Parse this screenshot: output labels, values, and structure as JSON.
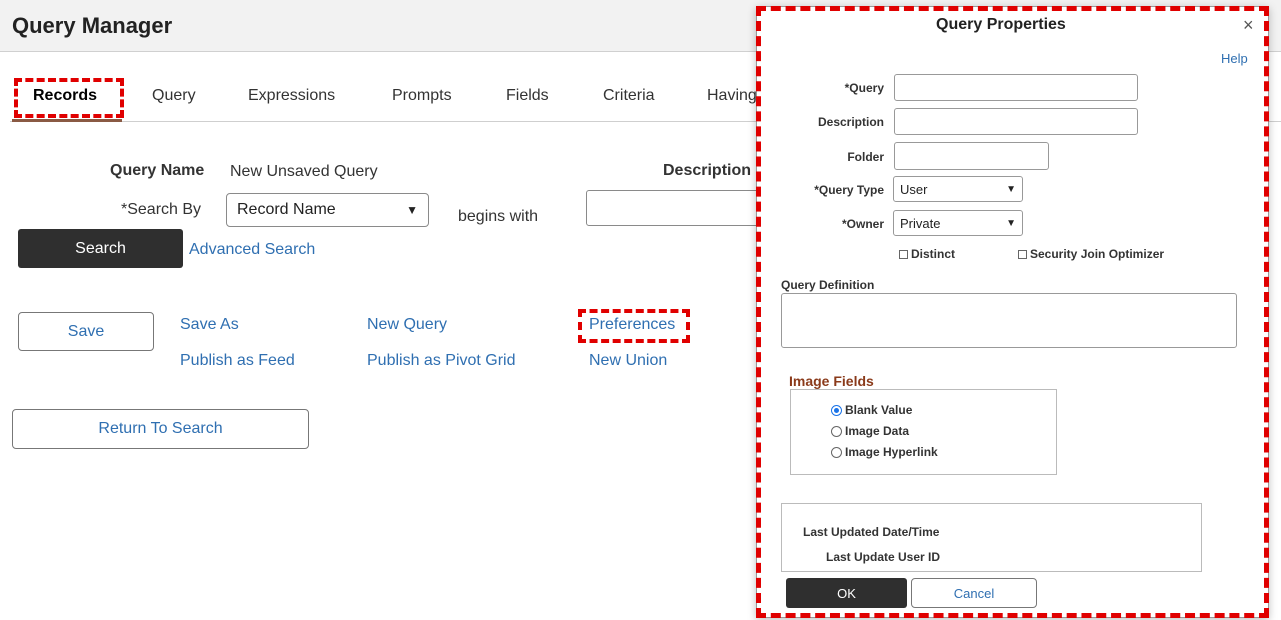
{
  "app": {
    "title": "Query Manager"
  },
  "tabs": [
    {
      "label": "Records"
    },
    {
      "label": "Query"
    },
    {
      "label": "Expressions"
    },
    {
      "label": "Prompts"
    },
    {
      "label": "Fields"
    },
    {
      "label": "Criteria"
    },
    {
      "label": "Having"
    }
  ],
  "search_panel": {
    "query_name_label": "Query Name",
    "query_name_value": "New Unsaved Query",
    "description_label": "Description",
    "search_by_label": "*Search By",
    "search_by_value": "Record Name",
    "begins_with_label": "begins with",
    "search_button": "Search",
    "advanced_search": "Advanced Search"
  },
  "actions": {
    "save": "Save",
    "save_as": "Save As",
    "new_query": "New Query",
    "preferences": "Preferences",
    "publish_feed": "Publish as Feed",
    "publish_pivot": "Publish as Pivot Grid",
    "new_union": "New Union",
    "return_to_search": "Return To Search"
  },
  "modal": {
    "title": "Query Properties",
    "close_glyph": "×",
    "help": "Help",
    "query_label": "*Query",
    "query_value": "",
    "description_label": "Description",
    "description_value": "",
    "folder_label": "Folder",
    "folder_value": "",
    "query_type_label": "*Query Type",
    "query_type_value": "User",
    "owner_label": "*Owner",
    "owner_value": "Private",
    "distinct_label": "Distinct",
    "security_join_label": "Security Join Optimizer",
    "query_definition_label": "Query Definition",
    "image_fields": {
      "title": "Image Fields",
      "options": [
        "Blank Value",
        "Image Data",
        "Image Hyperlink"
      ],
      "selected": "Blank Value"
    },
    "last_updated_label": "Last Updated Date/Time",
    "last_update_user_label": "Last Update User ID",
    "ok_button": "OK",
    "cancel_button": "Cancel"
  },
  "colors": {
    "accent_link": "#2f6fb1",
    "highlight": "#e00000",
    "section_title": "#8a3a1a"
  }
}
